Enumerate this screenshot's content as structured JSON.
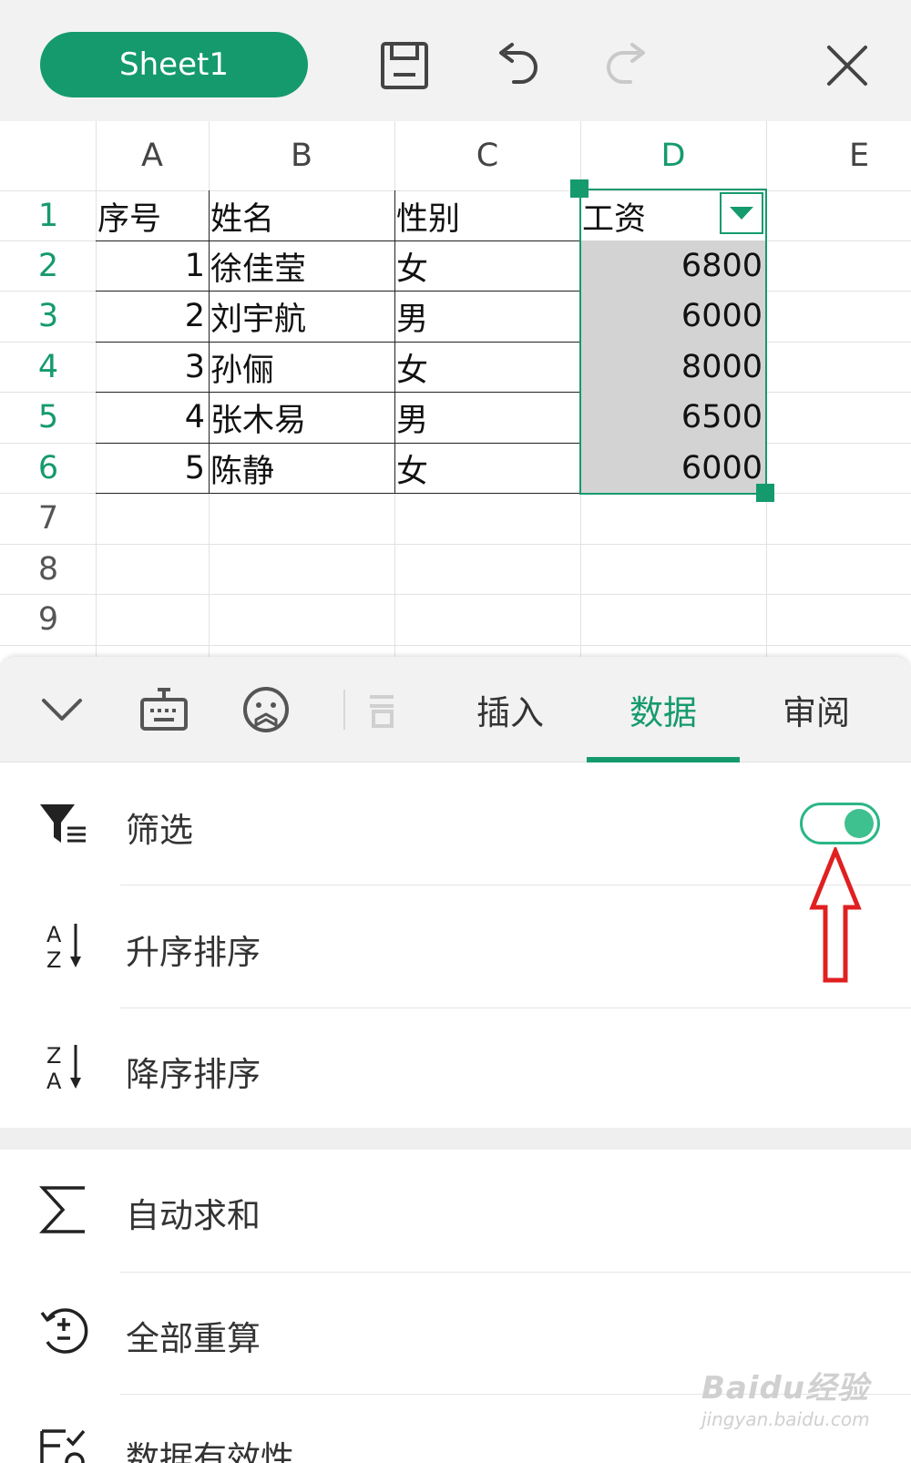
{
  "toolbar": {
    "sheet_tab": "Sheet1",
    "icons": [
      "save-icon",
      "undo-icon",
      "redo-icon",
      "close-icon"
    ]
  },
  "sheet": {
    "columns": [
      "A",
      "B",
      "C",
      "D",
      "E"
    ],
    "active_column": "D",
    "row_numbers": [
      "1",
      "2",
      "3",
      "4",
      "5",
      "6",
      "7",
      "8",
      "9"
    ],
    "active_rows": [
      "1",
      "2",
      "3",
      "4",
      "5",
      "6"
    ],
    "header": {
      "a": "序号",
      "b": "姓名",
      "c": "性别",
      "d": "工资"
    },
    "rows": [
      {
        "a": "1",
        "b": "徐佳莹",
        "c": "女",
        "d": "6800"
      },
      {
        "a": "2",
        "b": "刘宇航",
        "c": "男",
        "d": "6000"
      },
      {
        "a": "3",
        "b": "孙俪",
        "c": "女",
        "d": "8000"
      },
      {
        "a": "4",
        "b": "张木易",
        "c": "男",
        "d": "6500"
      },
      {
        "a": "5",
        "b": "陈静",
        "c": "女",
        "d": "6000"
      }
    ],
    "selection_color": "#159a6e",
    "selection_fill": "#d3d3d3"
  },
  "ribbon": {
    "icons": [
      "chevron-down-icon",
      "keyboard-icon",
      "emoji-icon",
      "view-icon"
    ],
    "tabs": [
      "插入",
      "数据",
      "审阅"
    ],
    "active_tab": "数据"
  },
  "menu": {
    "filter": {
      "label": "筛选",
      "icon": "filter-icon",
      "enabled": true
    },
    "sort_asc": {
      "label": "升序排序",
      "icon": "sort-ascending-icon"
    },
    "sort_desc": {
      "label": "降序排序",
      "icon": "sort-descending-icon"
    },
    "auto_sum": {
      "label": "自动求和",
      "icon": "sigma-icon"
    },
    "recalc": {
      "label": "全部重算",
      "icon": "recalculate-icon"
    },
    "validation": {
      "label": "数据有效性",
      "icon": "data-validation-icon"
    }
  },
  "watermark": {
    "main": "Baidu经验",
    "sub": "jingyan.baidu.com"
  },
  "colors": {
    "accent": "#159a6e",
    "toggle": "#3fc08f",
    "annotation_arrow": "#e02020"
  }
}
